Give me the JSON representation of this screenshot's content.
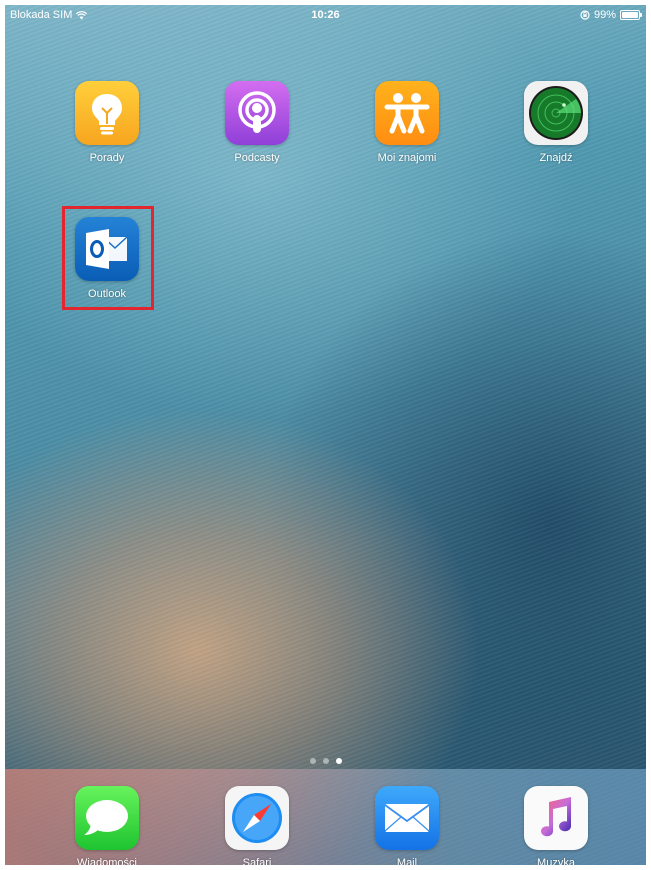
{
  "status_bar": {
    "carrier": "Blokada SIM",
    "time": "10:26",
    "battery_percent": "99%",
    "battery_level": 0.99
  },
  "apps": [
    {
      "label": "Porady",
      "icon": "lightbulb-icon"
    },
    {
      "label": "Podcasty",
      "icon": "podcast-icon"
    },
    {
      "label": "Moi znajomi",
      "icon": "friends-icon"
    },
    {
      "label": "Znajdź",
      "icon": "radar-icon"
    },
    {
      "label": "Outlook",
      "icon": "outlook-icon"
    }
  ],
  "page_indicator": {
    "pages": 3,
    "current": 3
  },
  "dock": [
    {
      "label": "Wiadomości",
      "icon": "speech-bubble-icon"
    },
    {
      "label": "Safari",
      "icon": "compass-icon"
    },
    {
      "label": "Mail",
      "icon": "envelope-icon"
    },
    {
      "label": "Muzyka",
      "icon": "music-note-icon"
    }
  ],
  "colors": {
    "highlight": "#e3262e"
  }
}
